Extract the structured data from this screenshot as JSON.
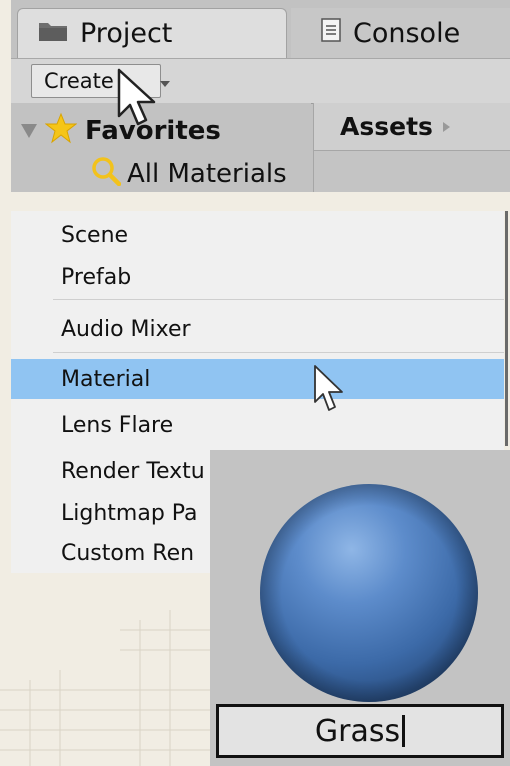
{
  "project_panel": {
    "tabs": [
      {
        "label": "Project",
        "icon": "folder-icon",
        "active": true
      },
      {
        "label": "Console",
        "icon": "console-icon",
        "active": false
      }
    ],
    "toolbar": {
      "create_label": "Create"
    },
    "sidebar": {
      "favorites_label": "Favorites",
      "items": [
        {
          "label": "All Materials",
          "icon": "search-icon"
        }
      ]
    },
    "assets_label": "Assets"
  },
  "create_menu": {
    "items": [
      {
        "label": "Scene"
      },
      {
        "label": "Prefab"
      },
      {
        "label": "Audio Mixer"
      },
      {
        "label": "Material",
        "selected": true
      },
      {
        "label": "Lens Flare"
      },
      {
        "label": "Render Textu"
      },
      {
        "label": "Lightmap Pa"
      },
      {
        "label": "Custom Ren"
      }
    ],
    "selected_color": "#90c4f2"
  },
  "material_preview": {
    "name_value": "Grass",
    "sphere_color": "#4a78b4"
  }
}
